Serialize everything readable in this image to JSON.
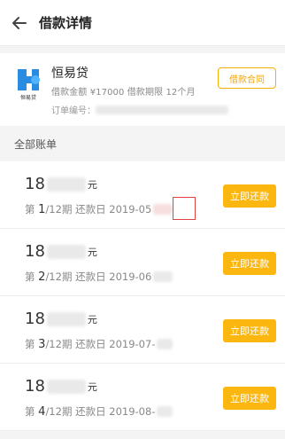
{
  "header": {
    "title": "借款详情"
  },
  "loan": {
    "logo_label": "恒易贷",
    "name": "恒易贷",
    "amount_label": "借款金额",
    "amount": "¥17000",
    "term_label": "借款期限",
    "term": "12个月",
    "order_label": "订单编号：",
    "contract_label": "借款合同"
  },
  "section": {
    "label": "全部账单"
  },
  "bills": [
    {
      "amount": "18",
      "unit": "元",
      "prefix": "第",
      "index": "1",
      "term_suffix": "/12期",
      "due_label": "还款日",
      "due": "2019-05",
      "pay_label": "立即还款"
    },
    {
      "amount": "18",
      "unit": "元",
      "prefix": "第",
      "index": "2",
      "term_suffix": "/12期",
      "due_label": "还款日",
      "due": "2019-06",
      "pay_label": "立即还款"
    },
    {
      "amount": "18",
      "unit": "元",
      "prefix": "第",
      "index": "3",
      "term_suffix": "/12期",
      "due_label": "还款日",
      "due": "2019-07-",
      "pay_label": "立即还款"
    },
    {
      "amount": "18",
      "unit": "元",
      "prefix": "第",
      "index": "4",
      "term_suffix": "/12期",
      "due_label": "还款日",
      "due": "2019-08-",
      "pay_label": "立即还款"
    }
  ],
  "colors": {
    "accent": "#fbb70f",
    "outline": "#f5b000",
    "highlight": "#e14343",
    "logo_blue": "#2a8ce0"
  },
  "icons": {
    "back": "arrow-left-icon",
    "logo": "hengyidai-logo-icon"
  }
}
